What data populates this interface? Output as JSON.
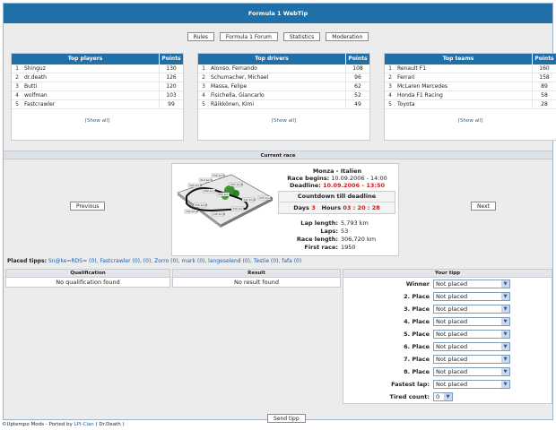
{
  "title": "Formula 1 WebTip",
  "nav": [
    "Rules",
    "Formula 1 Forum",
    "Statistics",
    "Moderation"
  ],
  "top_players": {
    "header": "Top players",
    "points_header": "Points",
    "rows": [
      {
        "n": "1",
        "name": "Shinguz",
        "pts": "130"
      },
      {
        "n": "2",
        "name": "dr.death",
        "pts": "126"
      },
      {
        "n": "3",
        "name": "Butti",
        "pts": "120"
      },
      {
        "n": "4",
        "name": "wolfman",
        "pts": "103"
      },
      {
        "n": "5",
        "name": "Fastcrawler",
        "pts": "99"
      }
    ],
    "show_all": "[Show all]"
  },
  "top_drivers": {
    "header": "Top drivers",
    "points_header": "Points",
    "rows": [
      {
        "n": "1",
        "name": "Alonso, Fernando",
        "pts": "108"
      },
      {
        "n": "2",
        "name": "Schumacher, Michael",
        "pts": "96"
      },
      {
        "n": "3",
        "name": "Massa, Felipe",
        "pts": "62"
      },
      {
        "n": "4",
        "name": "Fisichella, Giancarlo",
        "pts": "52"
      },
      {
        "n": "5",
        "name": "Räikkönen, Kimi",
        "pts": "49"
      }
    ],
    "show_all": "[Show all]"
  },
  "top_teams": {
    "header": "Top teams",
    "points_header": "Points",
    "rows": [
      {
        "n": "1",
        "name": "Renault F1",
        "pts": "160"
      },
      {
        "n": "2",
        "name": "Ferrari",
        "pts": "158"
      },
      {
        "n": "3",
        "name": "McLaren Mercedes",
        "pts": "89"
      },
      {
        "n": "4",
        "name": "Honda F1 Racing",
        "pts": "58"
      },
      {
        "n": "5",
        "name": "Toyota",
        "pts": "28"
      }
    ],
    "show_all": "[Show all]"
  },
  "current_race": {
    "section_title": "Current race",
    "previous": "Previous",
    "next": "Next",
    "name": "Monza - Italien",
    "begins_label": "Race begins:",
    "begins_value": "10.09.2006 - 14:00",
    "deadline_label": "Deadline:",
    "deadline_value": "10.09.2006 - 13:50",
    "countdown_title": "Countdown till deadline",
    "days_label": "Days",
    "days_value": "3",
    "hours_label": "Hours",
    "hours_value": "03 : 20 : 28",
    "lap_length_label": "Lap length:",
    "lap_length_value": "5,793 km",
    "laps_label": "Laps:",
    "laps_value": "53",
    "race_length_label": "Race length:",
    "race_length_value": "306,720 km",
    "first_race_label": "First race:",
    "first_race_value": "1950",
    "speed_labels": [
      "330 km/h",
      "310 km/h",
      "305 km/h",
      "320 km/h",
      "280 km/h",
      "330 km/h",
      "342 km/h",
      "320 km/h",
      "150 km/h",
      "340 km/h",
      "240 km/h",
      "330 km/h"
    ]
  },
  "placed_tipps": {
    "label": "Placed tipps:",
    "text": "Sn@ke=RDS= (0), Fastcrawler (0), (0), Zorro (0), mark (0), langeselend (0), Testie (0), fafa (0)"
  },
  "qualification": {
    "header": "Qualification",
    "value": "No qualification found"
  },
  "result": {
    "header": "Result",
    "value": "No result found"
  },
  "your_tipp": {
    "header": "Your tipp",
    "rows": [
      {
        "label": "Winner",
        "value": "Not placed"
      },
      {
        "label": "2. Place",
        "value": "Not placed"
      },
      {
        "label": "3. Place",
        "value": "Not placed"
      },
      {
        "label": "4. Place",
        "value": "Not placed"
      },
      {
        "label": "5. Place",
        "value": "Not placed"
      },
      {
        "label": "6. Place",
        "value": "Not placed"
      },
      {
        "label": "7. Place",
        "value": "Not placed"
      },
      {
        "label": "8. Place",
        "value": "Not placed"
      },
      {
        "label": "Fastest lap:",
        "value": "Not placed"
      }
    ],
    "tired_label": "Tired count:",
    "tired_value": "0"
  },
  "send_button": "Send tipp",
  "footer": {
    "prefix": "©Uptempo Mods - Ported by ",
    "link": "LPI-Clan",
    "suffix": " ( Dr.Death )"
  },
  "colors": {
    "header_blue": "#1f6fa8",
    "deadline_red": "#d21a1a",
    "link_blue": "#1f5ea8"
  }
}
